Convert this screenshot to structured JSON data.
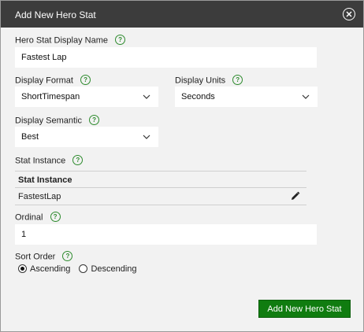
{
  "dialog": {
    "title": "Add New Hero Stat",
    "close_icon": "close-circle-icon"
  },
  "form": {
    "display_name": {
      "label": "Hero Stat Display Name",
      "value": "Fastest Lap"
    },
    "display_format": {
      "label": "Display Format",
      "value": "ShortTimespan"
    },
    "display_units": {
      "label": "Display Units",
      "value": "Seconds"
    },
    "display_semantic": {
      "label": "Display Semantic",
      "value": "Best"
    },
    "stat_instance": {
      "label": "Stat Instance",
      "column_header": "Stat Instance",
      "rows": [
        {
          "value": "FastestLap",
          "action_icon": "pencil-icon"
        }
      ]
    },
    "ordinal": {
      "label": "Ordinal",
      "value": "1"
    },
    "sort_order": {
      "label": "Sort Order",
      "options": [
        {
          "label": "Ascending",
          "selected": true
        },
        {
          "label": "Descending",
          "selected": false
        }
      ]
    },
    "help_glyph": "?"
  },
  "actions": {
    "submit_label": "Add New Hero Stat"
  },
  "colors": {
    "accent": "#107c10",
    "help": "#2e8b2e",
    "titlebar": "#3c3c3c"
  }
}
